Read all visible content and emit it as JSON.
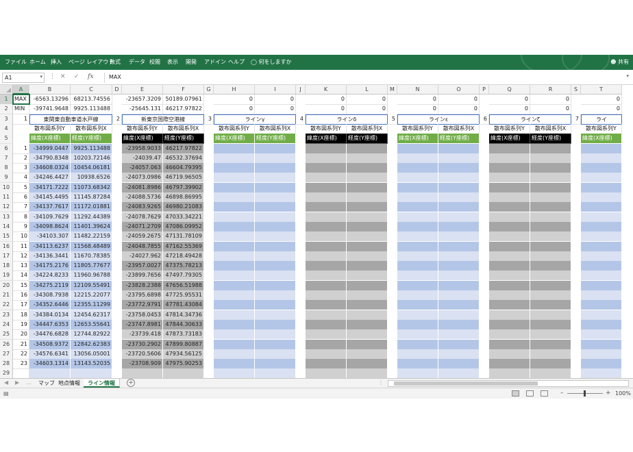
{
  "ribbon": {
    "tabs": [
      "ファイル",
      "ホーム",
      "挿入",
      "ページ レイアウト",
      "数式",
      "データ",
      "校閲",
      "表示",
      "開発",
      "アドイン",
      "ヘルプ"
    ],
    "tell_me": "何をしますか",
    "share": "共有"
  },
  "formula_bar": {
    "name_box": "A1",
    "fx": "fx",
    "value": "MAX"
  },
  "columns": [
    "A",
    "B",
    "C",
    "D",
    "E",
    "F",
    "G",
    "H",
    "I",
    "J",
    "K",
    "L",
    "M",
    "N",
    "O",
    "P",
    "Q",
    "R",
    "S",
    "T"
  ],
  "rows": [
    "1",
    "2",
    "3",
    "4",
    "5",
    "6",
    "7",
    "8",
    "9",
    "10",
    "11",
    "12",
    "13",
    "14",
    "15",
    "16",
    "17",
    "18",
    "19",
    "20",
    "21",
    "22",
    "23",
    "24",
    "25",
    "26",
    "27",
    "28",
    "29"
  ],
  "labels": {
    "max": "MAX",
    "min": "MIN",
    "max_values": [
      "-6563.13296",
      "68213.74556",
      "-23657.3209",
      "50189.07961",
      "0",
      "0",
      "0",
      "0",
      "0",
      "0",
      "0",
      "0",
      "0"
    ],
    "min_values": [
      "-39741.9648",
      "9925.113488",
      "-25645.131",
      "46217.97822",
      "0",
      "0",
      "0",
      "0",
      "0",
      "0",
      "0",
      "0",
      "0"
    ]
  },
  "sections": [
    {
      "num": "1",
      "title": "東関東自動車道水戸線"
    },
    {
      "num": "2",
      "title": "新東京国際空港線"
    },
    {
      "num": "3",
      "title": "ラインγ"
    },
    {
      "num": "4",
      "title": "ラインδ"
    },
    {
      "num": "5",
      "title": "ラインε"
    },
    {
      "num": "6",
      "title": "ラインζ"
    },
    {
      "num": "7",
      "title": "ライ"
    }
  ],
  "series_labels": {
    "y": "散布図系列Y",
    "x": "散布図系列X",
    "y_short": "散布図系列Y",
    "x_short": "散布図系列X"
  },
  "coord_labels": {
    "lat": "緯度(X座標)",
    "lon": "経度(Y座標)"
  },
  "line1": {
    "index": [
      "1",
      "2",
      "3",
      "4",
      "5",
      "6",
      "7",
      "8",
      "9",
      "10",
      "11",
      "12",
      "13",
      "14",
      "15",
      "16",
      "17",
      "18",
      "19",
      "20",
      "21",
      "22",
      "23"
    ],
    "x": [
      "-34999.0447",
      "-34790.8348",
      "-34608.0324",
      "-34246.4427",
      "-34171.7222",
      "-34145.4495",
      "-34137.7617",
      "-34109.7629",
      "-34098.8624",
      "-34103.307",
      "-34113.6237",
      "-34136.3441",
      "-34175.2176",
      "-34224.8233",
      "-34275.2119",
      "-34308.7938",
      "-34352.6446",
      "-34384.0134",
      "-34447.6353",
      "-34476.6828",
      "-34508.9372",
      "-34576.6341",
      "-34603.1314"
    ],
    "y": [
      "9925.113488",
      "10203.72146",
      "10454.06181",
      "10938.6526",
      "11073.68342",
      "11145.87284",
      "11172.01881",
      "11292.44389",
      "11401.39624",
      "11482.22159",
      "11568.48489",
      "11670.78385",
      "11805.77677",
      "11960.96788",
      "12109.55491",
      "12215.22077",
      "12355.11299",
      "12454.62317",
      "12653.55641",
      "12744.82922",
      "12842.62383",
      "13056.05001",
      "13143.52035"
    ]
  },
  "line2": {
    "x": [
      "-23958.9033",
      "-24039.47",
      "-24057.063",
      "-24073.0986",
      "-24081.8986",
      "-24088.5736",
      "-24083.9265",
      "-24078.7629",
      "-24071.2709",
      "-24059.2675",
      "-24048.7855",
      "-24027.962",
      "-23957.0027",
      "-23899.7656",
      "-23828.2388",
      "-23795.6898",
      "-23772.9791",
      "-23758.0453",
      "-23747.8981",
      "-23739.418",
      "-23730.2902",
      "-23720.5606",
      "-23708.909"
    ],
    "y": [
      "46217.97822",
      "46532.37694",
      "46604.79395",
      "46719.96505",
      "46797.39902",
      "46898.86995",
      "46980.21083",
      "47033.34221",
      "47086.09952",
      "47131.78109",
      "47162.55369",
      "47218.49428",
      "47375.78213",
      "47497.79305",
      "47656.51988",
      "47725.95531",
      "47781.43084",
      "47814.34736",
      "47844.30633",
      "47873.73183",
      "47899.80887",
      "47934.56125",
      "47975.90253"
    ]
  },
  "sheet_tabs": [
    "マップ",
    "地点情報",
    "ライン情報"
  ],
  "status": {
    "zoom": "100%"
  }
}
